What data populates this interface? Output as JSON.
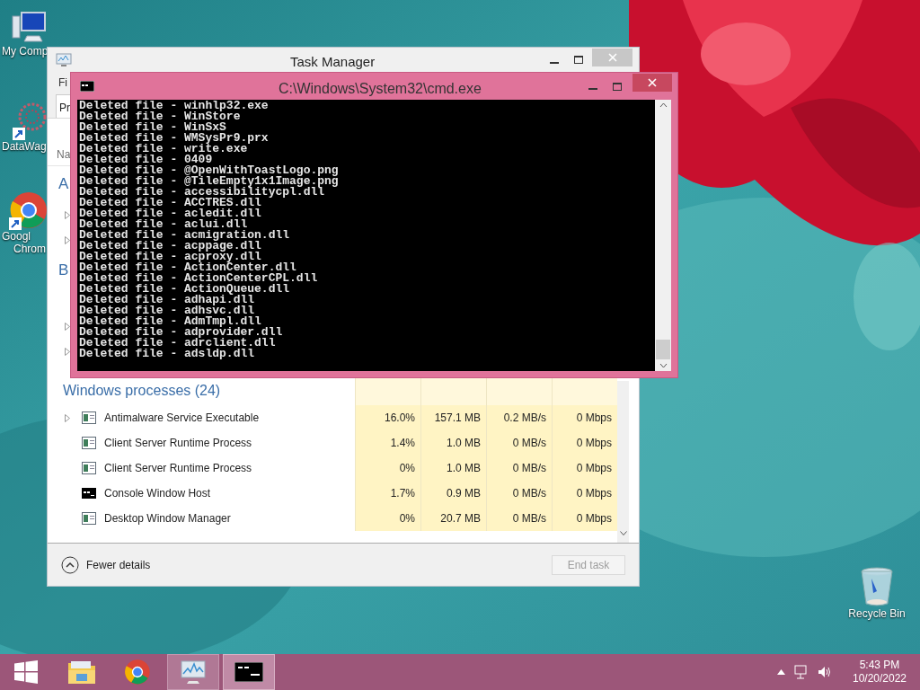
{
  "desktop_icons": [
    {
      "kind": "computer",
      "lines": [
        "My Comp"
      ]
    },
    {
      "kind": "datawag",
      "lines": [
        "DataWag"
      ]
    },
    {
      "kind": "chrome",
      "lines": [
        "Googl",
        "Chrom"
      ]
    },
    {
      "kind": "recycle",
      "lines": [
        "Recycle Bin"
      ]
    }
  ],
  "task_manager": {
    "title": "Task Manager",
    "menu_item": "Fi",
    "tab": "Pr",
    "column_header": "Na",
    "groups": [
      {
        "header": "A",
        "rows": [
          {
            "expandable": true
          },
          {
            "expandable": true
          }
        ]
      },
      {
        "header": "B",
        "rows": [
          {
            "expandable": false
          },
          {
            "expandable": true
          },
          {
            "expandable": true
          }
        ]
      }
    ],
    "windows_processes": {
      "header": "Windows processes (24)",
      "rows": [
        {
          "kind": "app",
          "expandable": true,
          "name": "Antimalware Service Executable",
          "cpu": "16.0%",
          "memory": "157.1 MB",
          "disk": "0.2 MB/s",
          "network": "0 Mbps"
        },
        {
          "kind": "app",
          "expandable": false,
          "name": "Client Server Runtime Process",
          "cpu": "1.4%",
          "memory": "1.0 MB",
          "disk": "0 MB/s",
          "network": "0 Mbps"
        },
        {
          "kind": "app",
          "expandable": false,
          "name": "Client Server Runtime Process",
          "cpu": "0%",
          "memory": "1.0 MB",
          "disk": "0 MB/s",
          "network": "0 Mbps"
        },
        {
          "kind": "console",
          "expandable": false,
          "name": "Console Window Host",
          "cpu": "1.7%",
          "memory": "0.9 MB",
          "disk": "0 MB/s",
          "network": "0 Mbps"
        },
        {
          "kind": "app",
          "expandable": false,
          "name": "Desktop Window Manager",
          "cpu": "0%",
          "memory": "20.7 MB",
          "disk": "0 MB/s",
          "network": "0 Mbps"
        }
      ]
    },
    "fewer_details": "Fewer details",
    "end_task": {
      "label": "End task",
      "disabled": true
    }
  },
  "cmd": {
    "title": "C:\\Windows\\System32\\cmd.exe",
    "lines": [
      "Deleted file - winhlp32.exe",
      "Deleted file - WinStore",
      "Deleted file - WinSxS",
      "Deleted file - WMSysPr9.prx",
      "Deleted file - write.exe",
      "Deleted file - 0409",
      "Deleted file - @OpenWithToastLogo.png",
      "Deleted file - @TileEmpty1x1Image.png",
      "Deleted file - accessibilitycpl.dll",
      "Deleted file - ACCTRES.dll",
      "Deleted file - acledit.dll",
      "Deleted file - aclui.dll",
      "Deleted file - acmigration.dll",
      "Deleted file - acppage.dll",
      "Deleted file - acproxy.dll",
      "Deleted file - ActionCenter.dll",
      "Deleted file - ActionCenterCPL.dll",
      "Deleted file - ActionQueue.dll",
      "Deleted file - adhapi.dll",
      "Deleted file - adhsvc.dll",
      "Deleted file - AdmTmpl.dll",
      "Deleted file - adprovider.dll",
      "Deleted file - adrclient.dll",
      "Deleted file - adsldp.dll"
    ]
  },
  "taskbar": {
    "items": [
      {
        "kind": "start",
        "open": false,
        "selected": false
      },
      {
        "kind": "explorer",
        "open": false,
        "selected": false
      },
      {
        "kind": "chrome",
        "open": false,
        "selected": false
      },
      {
        "kind": "taskmgr",
        "open": true,
        "selected": false
      },
      {
        "kind": "cmd",
        "open": true,
        "selected": true
      }
    ],
    "time": "5:43 PM",
    "date": "10/20/2022"
  }
}
